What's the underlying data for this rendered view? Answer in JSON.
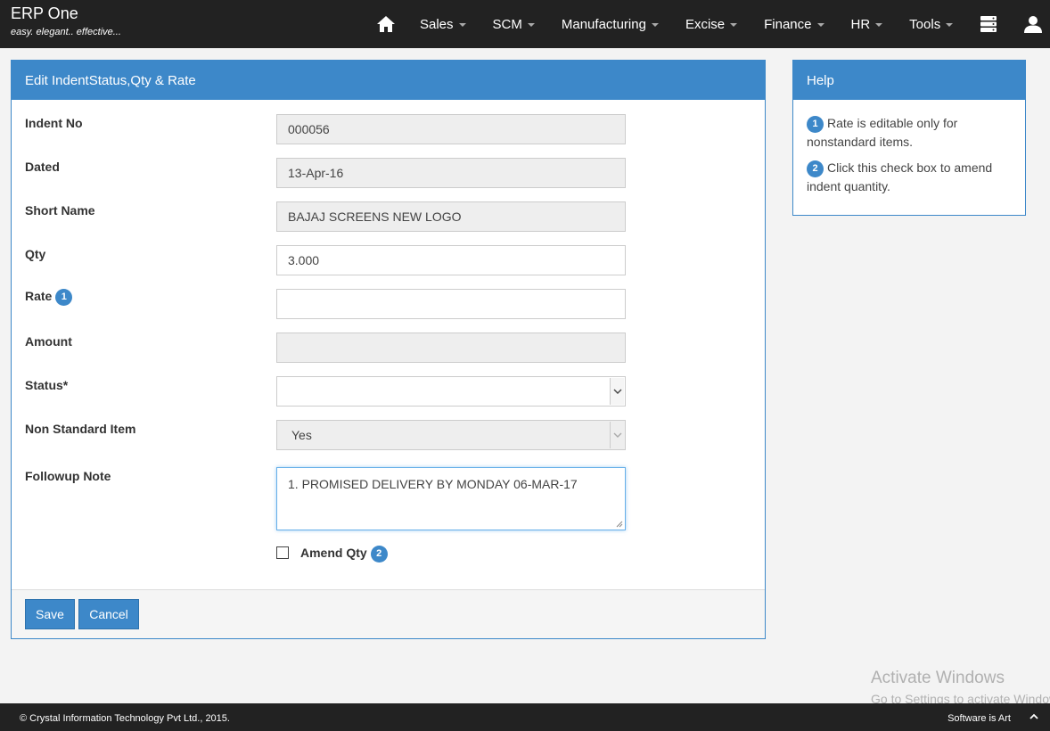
{
  "brand": {
    "title": "ERP One",
    "tagline": "easy. elegant.. effective..."
  },
  "nav": {
    "items": [
      {
        "label": "Sales"
      },
      {
        "label": "SCM"
      },
      {
        "label": "Manufacturing"
      },
      {
        "label": "Excise"
      },
      {
        "label": "Finance"
      },
      {
        "label": "HR"
      },
      {
        "label": "Tools"
      }
    ],
    "icons": [
      "home-icon",
      "database-icon",
      "user-icon"
    ]
  },
  "form": {
    "title": "Edit IndentStatus,Qty & Rate",
    "indent_no": {
      "label": "Indent No",
      "value": "000056"
    },
    "dated": {
      "label": "Dated",
      "value": "13-Apr-16"
    },
    "short_name": {
      "label": "Short Name",
      "value": "BAJAJ SCREENS NEW LOGO"
    },
    "qty": {
      "label": "Qty",
      "value": "3.000"
    },
    "rate": {
      "label": "Rate",
      "badge": "1",
      "value": ""
    },
    "amount": {
      "label": "Amount",
      "value": ""
    },
    "status": {
      "label": "Status*",
      "value": ""
    },
    "non_standard": {
      "label": "Non Standard Item",
      "value": "Yes"
    },
    "followup": {
      "label": "Followup Note",
      "value": "1. PROMISED DELIVERY BY MONDAY 06-MAR-17"
    },
    "amend": {
      "label": "Amend Qty",
      "badge": "2",
      "checked": false
    },
    "save_label": "Save",
    "cancel_label": "Cancel"
  },
  "help": {
    "title": "Help",
    "items": [
      {
        "num": "1",
        "text": "Rate is editable only for nonstandard items."
      },
      {
        "num": "2",
        "text": "Click this check box to amend indent quantity."
      }
    ]
  },
  "watermark": {
    "line1": "Activate Windows",
    "line2": "Go to Settings to activate Windows."
  },
  "footer": {
    "copyright": "© Crystal Information Technology Pvt Ltd., 2015.",
    "tagline": "Software is Art"
  },
  "colors": {
    "accent": "#3d88c9",
    "topbar": "#222222",
    "background": "#f3f3f3"
  }
}
